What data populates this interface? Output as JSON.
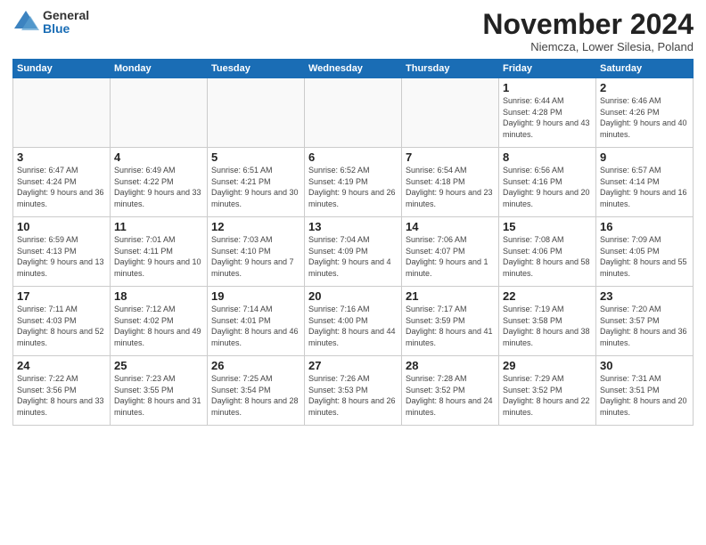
{
  "logo": {
    "general": "General",
    "blue": "Blue"
  },
  "header": {
    "month": "November 2024",
    "location": "Niemcza, Lower Silesia, Poland"
  },
  "weekdays": [
    "Sunday",
    "Monday",
    "Tuesday",
    "Wednesday",
    "Thursday",
    "Friday",
    "Saturday"
  ],
  "weeks": [
    [
      {
        "day": "",
        "info": ""
      },
      {
        "day": "",
        "info": ""
      },
      {
        "day": "",
        "info": ""
      },
      {
        "day": "",
        "info": ""
      },
      {
        "day": "",
        "info": ""
      },
      {
        "day": "1",
        "info": "Sunrise: 6:44 AM\nSunset: 4:28 PM\nDaylight: 9 hours\nand 43 minutes."
      },
      {
        "day": "2",
        "info": "Sunrise: 6:46 AM\nSunset: 4:26 PM\nDaylight: 9 hours\nand 40 minutes."
      }
    ],
    [
      {
        "day": "3",
        "info": "Sunrise: 6:47 AM\nSunset: 4:24 PM\nDaylight: 9 hours\nand 36 minutes."
      },
      {
        "day": "4",
        "info": "Sunrise: 6:49 AM\nSunset: 4:22 PM\nDaylight: 9 hours\nand 33 minutes."
      },
      {
        "day": "5",
        "info": "Sunrise: 6:51 AM\nSunset: 4:21 PM\nDaylight: 9 hours\nand 30 minutes."
      },
      {
        "day": "6",
        "info": "Sunrise: 6:52 AM\nSunset: 4:19 PM\nDaylight: 9 hours\nand 26 minutes."
      },
      {
        "day": "7",
        "info": "Sunrise: 6:54 AM\nSunset: 4:18 PM\nDaylight: 9 hours\nand 23 minutes."
      },
      {
        "day": "8",
        "info": "Sunrise: 6:56 AM\nSunset: 4:16 PM\nDaylight: 9 hours\nand 20 minutes."
      },
      {
        "day": "9",
        "info": "Sunrise: 6:57 AM\nSunset: 4:14 PM\nDaylight: 9 hours\nand 16 minutes."
      }
    ],
    [
      {
        "day": "10",
        "info": "Sunrise: 6:59 AM\nSunset: 4:13 PM\nDaylight: 9 hours\nand 13 minutes."
      },
      {
        "day": "11",
        "info": "Sunrise: 7:01 AM\nSunset: 4:11 PM\nDaylight: 9 hours\nand 10 minutes."
      },
      {
        "day": "12",
        "info": "Sunrise: 7:03 AM\nSunset: 4:10 PM\nDaylight: 9 hours\nand 7 minutes."
      },
      {
        "day": "13",
        "info": "Sunrise: 7:04 AM\nSunset: 4:09 PM\nDaylight: 9 hours\nand 4 minutes."
      },
      {
        "day": "14",
        "info": "Sunrise: 7:06 AM\nSunset: 4:07 PM\nDaylight: 9 hours\nand 1 minute."
      },
      {
        "day": "15",
        "info": "Sunrise: 7:08 AM\nSunset: 4:06 PM\nDaylight: 8 hours\nand 58 minutes."
      },
      {
        "day": "16",
        "info": "Sunrise: 7:09 AM\nSunset: 4:05 PM\nDaylight: 8 hours\nand 55 minutes."
      }
    ],
    [
      {
        "day": "17",
        "info": "Sunrise: 7:11 AM\nSunset: 4:03 PM\nDaylight: 8 hours\nand 52 minutes."
      },
      {
        "day": "18",
        "info": "Sunrise: 7:12 AM\nSunset: 4:02 PM\nDaylight: 8 hours\nand 49 minutes."
      },
      {
        "day": "19",
        "info": "Sunrise: 7:14 AM\nSunset: 4:01 PM\nDaylight: 8 hours\nand 46 minutes."
      },
      {
        "day": "20",
        "info": "Sunrise: 7:16 AM\nSunset: 4:00 PM\nDaylight: 8 hours\nand 44 minutes."
      },
      {
        "day": "21",
        "info": "Sunrise: 7:17 AM\nSunset: 3:59 PM\nDaylight: 8 hours\nand 41 minutes."
      },
      {
        "day": "22",
        "info": "Sunrise: 7:19 AM\nSunset: 3:58 PM\nDaylight: 8 hours\nand 38 minutes."
      },
      {
        "day": "23",
        "info": "Sunrise: 7:20 AM\nSunset: 3:57 PM\nDaylight: 8 hours\nand 36 minutes."
      }
    ],
    [
      {
        "day": "24",
        "info": "Sunrise: 7:22 AM\nSunset: 3:56 PM\nDaylight: 8 hours\nand 33 minutes."
      },
      {
        "day": "25",
        "info": "Sunrise: 7:23 AM\nSunset: 3:55 PM\nDaylight: 8 hours\nand 31 minutes."
      },
      {
        "day": "26",
        "info": "Sunrise: 7:25 AM\nSunset: 3:54 PM\nDaylight: 8 hours\nand 28 minutes."
      },
      {
        "day": "27",
        "info": "Sunrise: 7:26 AM\nSunset: 3:53 PM\nDaylight: 8 hours\nand 26 minutes."
      },
      {
        "day": "28",
        "info": "Sunrise: 7:28 AM\nSunset: 3:52 PM\nDaylight: 8 hours\nand 24 minutes."
      },
      {
        "day": "29",
        "info": "Sunrise: 7:29 AM\nSunset: 3:52 PM\nDaylight: 8 hours\nand 22 minutes."
      },
      {
        "day": "30",
        "info": "Sunrise: 7:31 AM\nSunset: 3:51 PM\nDaylight: 8 hours\nand 20 minutes."
      }
    ]
  ]
}
